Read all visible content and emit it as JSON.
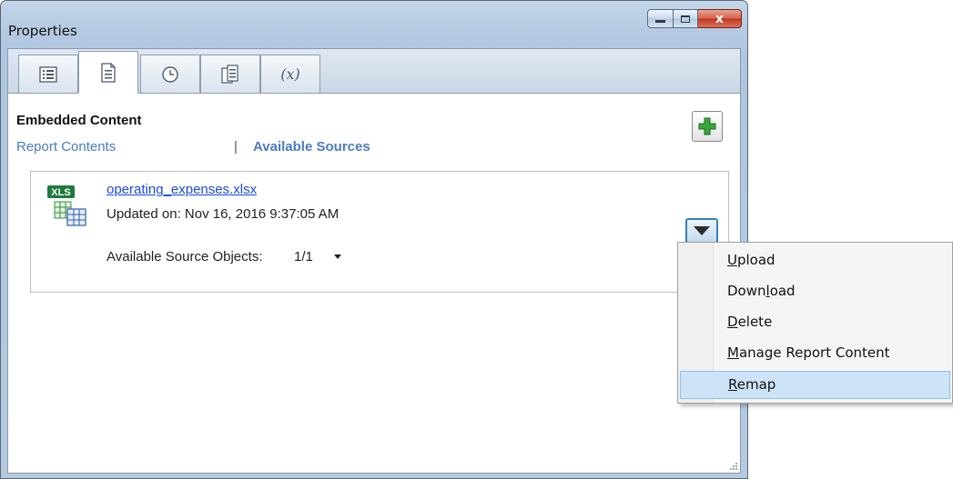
{
  "window": {
    "title": "Properties",
    "close_glyph": "x"
  },
  "tabs": [
    {
      "icon": "list-icon"
    },
    {
      "icon": "document-icon",
      "active": true
    },
    {
      "icon": "clock-icon"
    },
    {
      "icon": "copy-document-icon"
    },
    {
      "icon": "variable-icon",
      "label": "(x)"
    }
  ],
  "main": {
    "section_title": "Embedded Content",
    "nav": {
      "report_contents": "Report Contents",
      "separator": "|",
      "available_sources": "Available Sources"
    },
    "add_button_icon": "green-plus-icon"
  },
  "source": {
    "icon_label": "XLS",
    "file_name": "operating_expenses.xlsx",
    "updated": "Updated on: Nov 16, 2016 9:37:05 AM",
    "objects_label": "Available Source Objects:",
    "objects_value": "1/1"
  },
  "menu": {
    "items": [
      {
        "label": "Upload",
        "mnemonic": "U",
        "rest": "pload"
      },
      {
        "label": "Download",
        "pre": "Down",
        "mnemonic": "l",
        "rest": "oad"
      },
      {
        "label": "Delete",
        "mnemonic": "D",
        "rest": "elete"
      },
      {
        "label": "Manage Report Content",
        "mnemonic": "M",
        "rest": "anage Report Content"
      },
      {
        "label": "Remap",
        "mnemonic": "R",
        "rest": "emap",
        "highlighted": true
      }
    ]
  },
  "colors": {
    "link": "#1a4bdc",
    "nav_link": "#4a7cc1",
    "menu_highlight": "#cde3f7",
    "add_icon": "#3aa53a"
  }
}
